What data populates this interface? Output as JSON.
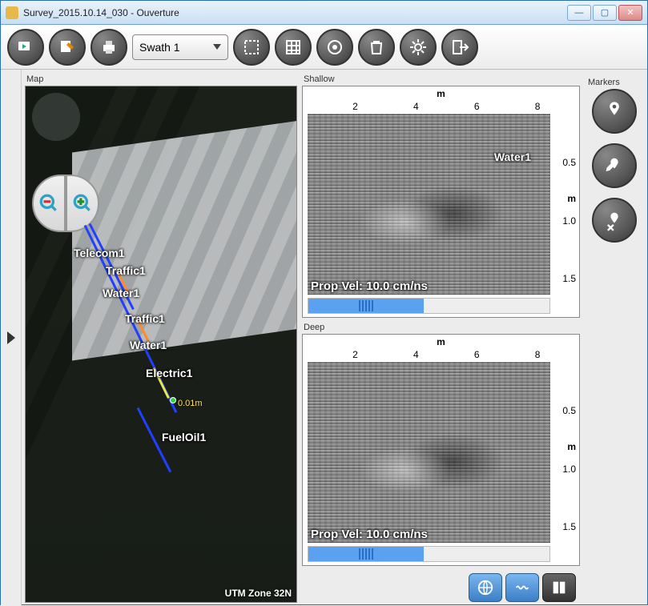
{
  "window": {
    "title": "Survey_2015.10.14_030 - Ouverture"
  },
  "toolbar": {
    "swath_label": "Swath 1",
    "icons": {
      "run": "run-icon",
      "edit": "edit-icon",
      "print": "print-icon",
      "select": "select-rect-icon",
      "grid": "grid-icon",
      "target": "target-icon",
      "delete": "trash-icon",
      "settings": "gear-icon",
      "exit": "exit-icon"
    }
  },
  "panels": {
    "map": "Map",
    "shallow": "Shallow",
    "deep": "Deep",
    "markers": "Markers"
  },
  "map": {
    "projection": "UTM Zone 32N",
    "distance_readout": "0.01m",
    "utilities": [
      {
        "name": "Telecom1"
      },
      {
        "name": "Traffic1"
      },
      {
        "name": "Water1"
      },
      {
        "name": "Traffic1"
      },
      {
        "name": "Water1"
      },
      {
        "name": "Electric1"
      },
      {
        "name": "FuelOil1"
      }
    ]
  },
  "radar": {
    "x_unit": "m",
    "depth_unit": "m",
    "x_ticks": [
      "2",
      "4",
      "6",
      "8"
    ],
    "shallow": {
      "depth_ticks": [
        "0.5",
        "1.0",
        "1.5"
      ],
      "prop_vel_label": "Prop Vel: 10.0 cm/ns",
      "tag": "Water1"
    },
    "deep": {
      "depth_ticks": [
        "0.5",
        "1.0",
        "1.5"
      ],
      "prop_vel_label": "Prop Vel: 10.0 cm/ns"
    }
  },
  "markers": {
    "icons": {
      "add": "pin-add-icon",
      "edit": "pin-edit-icon",
      "delete": "pin-delete-icon"
    }
  }
}
